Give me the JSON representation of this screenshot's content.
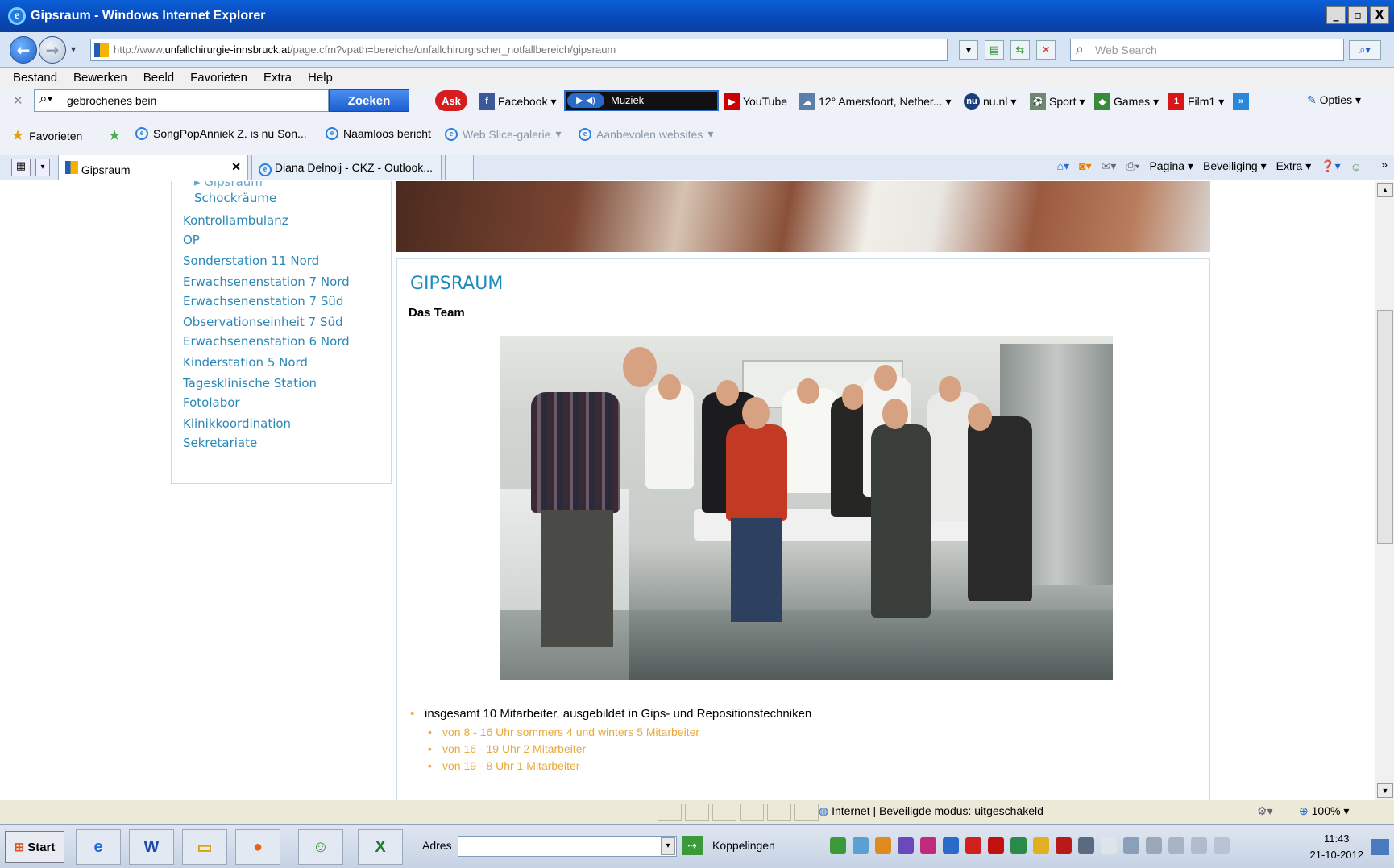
{
  "window": {
    "title": "Gipsraum - Windows Internet Explorer",
    "min": "_",
    "max": "▫",
    "close": "X"
  },
  "address": {
    "prefix": "http://www.",
    "domain": "unfallchirurgie-innsbruck.at",
    "path": "/page.cfm?vpath=bereiche/unfallchirurgischer_notfallbereich/gipsraum",
    "search_placeholder": "Web Search"
  },
  "menu": [
    "Bestand",
    "Bewerken",
    "Beeld",
    "Favorieten",
    "Extra",
    "Help"
  ],
  "toolbar": {
    "search_value": "gebrochenes bein",
    "search_button": "Zoeken",
    "ask": "Ask",
    "facebook": "Facebook",
    "muziek": "Muziek",
    "youtube": "YouTube",
    "weather": "12° Amersfoort, Nether...",
    "nu": "nu.nl",
    "sport": "Sport",
    "games": "Games",
    "film": "Film1",
    "opties": "Opties"
  },
  "favorites": {
    "label": "Favorieten",
    "items": [
      "SongPopAnniek Z. is nu Son...",
      "Naamloos bericht",
      "Web Slice-galerie",
      "Aanbevolen websites"
    ]
  },
  "tabs": [
    {
      "label": "Gipsraum"
    },
    {
      "label": "Diana Delnoij - CKZ - Outlook..."
    }
  ],
  "command_bar": [
    "Pagina",
    "Beveiliging",
    "Extra"
  ],
  "sidebar": {
    "items": [
      {
        "label": "Gipsraum",
        "sub": true,
        "cut": true
      },
      {
        "label": "Schockräume",
        "sub": true
      },
      {
        "label": "Kontrollambulanz"
      },
      {
        "label": "OP"
      },
      {
        "label": "Sonderstation 11 Nord"
      },
      {
        "label": "Erwachsenenstation 7 Nord"
      },
      {
        "label": "Erwachsenenstation 7 Süd"
      },
      {
        "label": "Observationseinheit 7 Süd"
      },
      {
        "label": "Erwachsenenstation 6 Nord"
      },
      {
        "label": "Kinderstation 5 Nord"
      },
      {
        "label": "Tagesklinische Station"
      },
      {
        "label": "Fotolabor"
      },
      {
        "label": "Klinikkoordination"
      },
      {
        "label": "Sekretariate"
      }
    ]
  },
  "content": {
    "heading": "GIPSRAUM",
    "subheading": "Das Team",
    "bullet": "insgesamt 10 Mitarbeiter, ausgebildet in Gips- und Repositionstechniken",
    "subbullets": [
      "von 8 - 16 Uhr sommers 4 und winters 5 Mitarbeiter",
      "von 16 - 19 Uhr 2 Mitarbeiter",
      "von 19 - 8 Uhr 1 Mitarbeiter"
    ]
  },
  "status": {
    "zone": "Internet | Beveiligde modus: uitgeschakeld",
    "zoom": "100%"
  },
  "taskbar": {
    "start": "Start",
    "adres": "Adres",
    "koppelingen": "Koppelingen",
    "time": "11:43",
    "date": "21-10-2012"
  }
}
